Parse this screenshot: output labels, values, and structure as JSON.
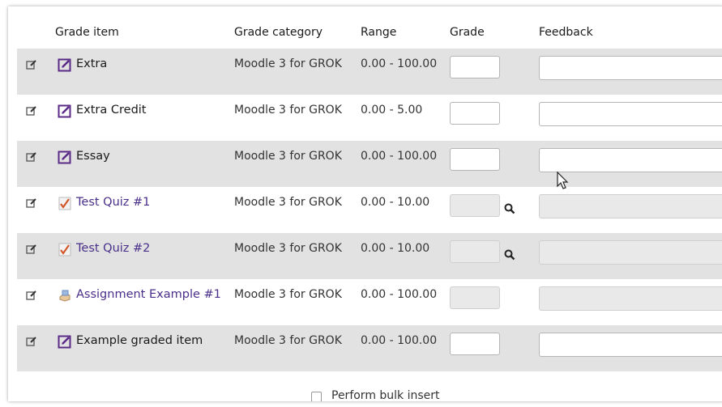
{
  "headers": {
    "grade_item": "Grade item",
    "grade_category": "Grade category",
    "range": "Range",
    "grade": "Grade",
    "feedback": "Feedback"
  },
  "rows": [
    {
      "name": "Extra",
      "type": "manual",
      "category": "Moodle 3 for GROK",
      "range": "0.00 - 100.00",
      "editable": true
    },
    {
      "name": "Extra Credit",
      "type": "manual",
      "category": "Moodle 3 for GROK",
      "range": "0.00 - 5.00",
      "editable": true
    },
    {
      "name": "Essay",
      "type": "manual",
      "category": "Moodle 3 for GROK",
      "range": "0.00 - 100.00",
      "editable": true
    },
    {
      "name": "Test Quiz #1",
      "type": "quiz",
      "category": "Moodle 3 for GROK",
      "range": "0.00 - 10.00",
      "editable": false
    },
    {
      "name": "Test Quiz #2",
      "type": "quiz",
      "category": "Moodle 3 for GROK",
      "range": "0.00 - 10.00",
      "editable": false
    },
    {
      "name": "Assignment Example #1",
      "type": "assignment",
      "category": "Moodle 3 for GROK",
      "range": "0.00 - 100.00",
      "editable": false
    },
    {
      "name": "Example graded item",
      "type": "manual",
      "category": "Moodle 3 for GROK",
      "range": "0.00 - 100.00",
      "editable": true
    }
  ],
  "bulk_insert_label": "Perform bulk insert",
  "colors": {
    "shaded_row": "#e2e2e2",
    "link": "#4a2f8a",
    "icon_purple": "#5b2a86"
  }
}
